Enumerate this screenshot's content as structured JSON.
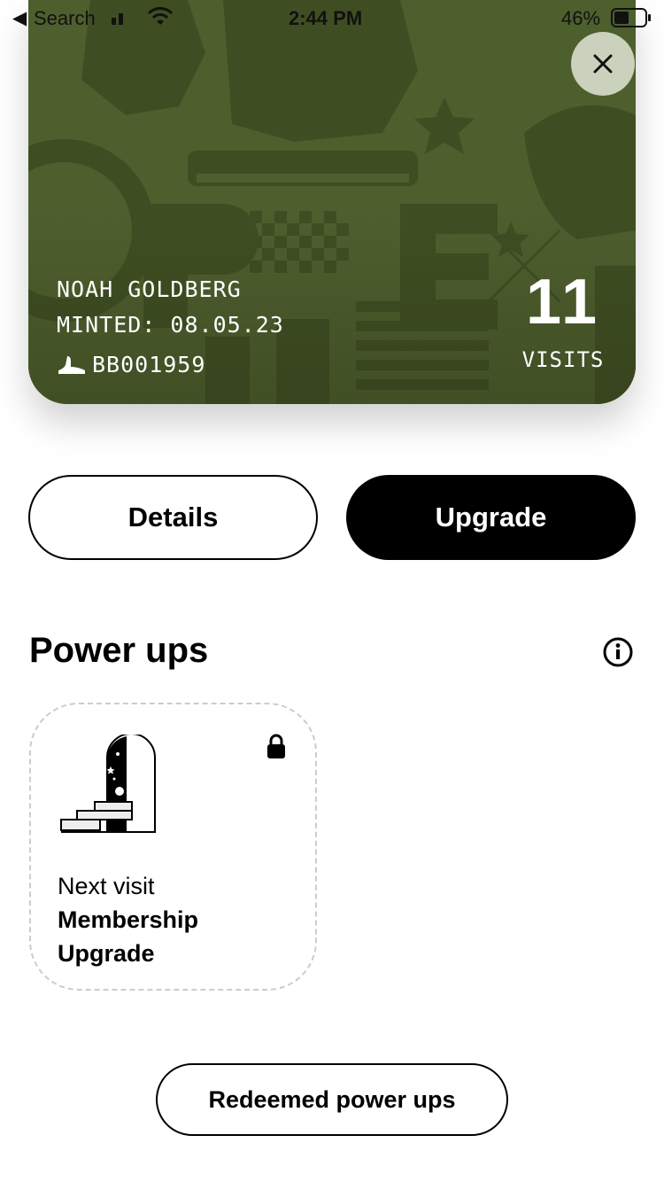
{
  "status_bar": {
    "back_label": "Search",
    "time": "2:44 PM",
    "battery": "46%"
  },
  "card": {
    "holder_name": "NOAH GOLDBERG",
    "minted": "MINTED: 08.05.23",
    "id": "BB001959",
    "visits_count": "11",
    "visits_label": "VISITS",
    "background_color": "#4e5f2e"
  },
  "actions": {
    "details_label": "Details",
    "upgrade_label": "Upgrade"
  },
  "power_ups": {
    "title": "Power ups",
    "items": [
      {
        "subtitle": "Next visit",
        "title": "Membership Upgrade",
        "locked": true
      }
    ],
    "redeemed_label": "Redeemed power ups"
  }
}
